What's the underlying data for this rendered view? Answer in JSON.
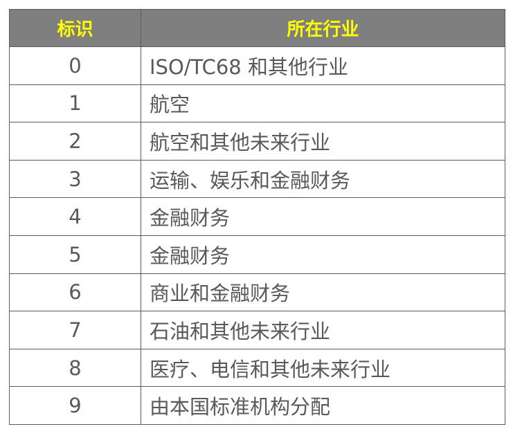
{
  "table": {
    "headers": {
      "id": "标识",
      "industry": "所在行业"
    },
    "rows": [
      {
        "id": "0",
        "industry": "ISO/TC68 和其他行业"
      },
      {
        "id": "1",
        "industry": "航空"
      },
      {
        "id": "2",
        "industry": "航空和其他未来行业"
      },
      {
        "id": "3",
        "industry": "运输、娱乐和金融财务"
      },
      {
        "id": "4",
        "industry": "金融财务"
      },
      {
        "id": "5",
        "industry": "金融财务"
      },
      {
        "id": "6",
        "industry": "商业和金融财务"
      },
      {
        "id": "7",
        "industry": "石油和其他未来行业"
      },
      {
        "id": "8",
        "industry": "医疗、电信和其他未来行业"
      },
      {
        "id": "9",
        "industry": "由本国标准机构分配"
      }
    ]
  },
  "colors": {
    "header_background": "#7f7f7f",
    "header_text": "#ffff00",
    "body_text": "#595959",
    "border": "#5a5a5a"
  }
}
